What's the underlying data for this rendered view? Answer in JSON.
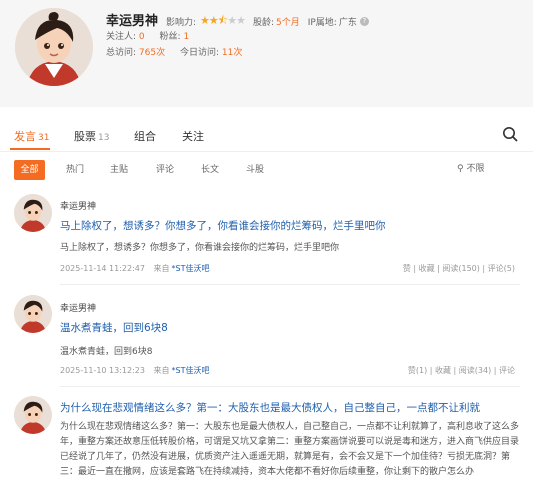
{
  "profile": {
    "name": "幸运男神",
    "influence_label": "影响力:",
    "influence_stars": 2.5,
    "age_label": "股龄:",
    "age_value": "5个月",
    "ip_label": "IP属地:",
    "ip_value": "广东",
    "followers_label": "关注人:",
    "followers_value": "0",
    "fans_label": "粉丝:",
    "fans_value": "1",
    "visits_label": "总访问:",
    "visits_value": "765次",
    "today_label": "今日访问:",
    "today_value": "11次"
  },
  "tabs": [
    {
      "label": "发言",
      "count": "31",
      "active": true
    },
    {
      "label": "股票",
      "count": "13",
      "active": false
    },
    {
      "label": "组合",
      "count": "",
      "active": false
    },
    {
      "label": "关注",
      "count": "",
      "active": false
    }
  ],
  "filters": [
    "全部",
    "热门",
    "主贴",
    "评论",
    "长文",
    "斗股"
  ],
  "filter_select": "不限",
  "posts": [
    {
      "author": "幸运男神",
      "title": "马上除权了，想诱多？你想多了，你看谁会接你的烂筹码，烂手里吧你",
      "body": "马上除权了，想诱多？你想多了，你看谁会接你的烂筹码，烂手里吧你",
      "time": "2025-11-14 11:22:47",
      "source": "来自",
      "stock": "*ST佳沃吧",
      "actions": "赞 | 收藏 | 阅读(150) | 评论(5)"
    },
    {
      "author": "幸运男神",
      "title": "温水煮青蛙，回到6块8",
      "body": "温水煮青蛙，回到6块8",
      "time": "2025-11-10 13:12:23",
      "source": "来自",
      "stock": "*ST佳沃吧",
      "actions": "赞(1) | 收藏 | 阅读(34) | 评论"
    }
  ],
  "long_post": {
    "title": "为什么现在悲观情绪这么多？第一：大股东也是最大债权人，自己整自己，一点都不让利就",
    "text": "为什么现在悲观情绪这么多？第一：大股东也是最大债权人，自己整自己，一点都不让利就算了，高利息收了这么多年，重整方案还故意压低转股价格，可谓是又坑又拿第二：重整方案画饼说要可以说是毒和迷方，进入商飞供应目录已经说了几年了，仍然没有进展，优质资产注入遥遥无期，就算是有，会不会又是下一个加佳待？亏损无底洞？第三：最近一直在撒网，应该是套路飞在持续减持，资本大佬都不看好你后续重整，你让剩下的散户怎么办"
  }
}
